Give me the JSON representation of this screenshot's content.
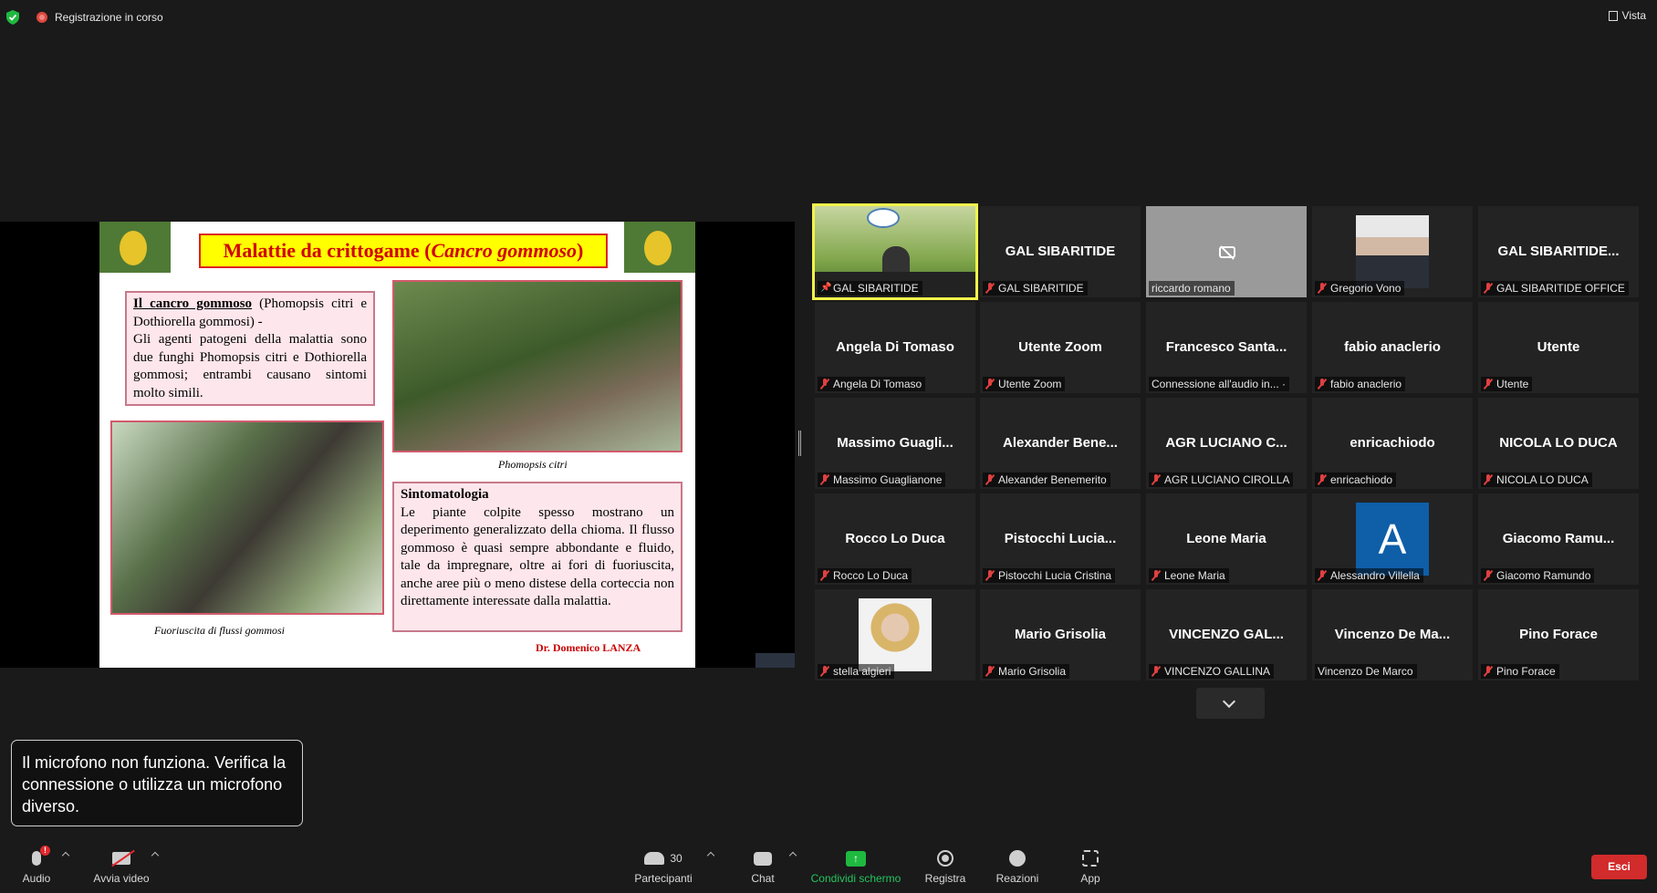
{
  "topbar": {
    "recording_label": "Registrazione in corso",
    "view_label": "Vista"
  },
  "slide": {
    "title_main": "Malattie da crittogame (",
    "title_italic": "Cancro gommoso",
    "title_end": ")",
    "box1_heading": "Il cancro gommoso",
    "box1_heading_rest": " (Phomopsis citri e Dothiorella gommosi) -",
    "box1_text": "Gli agenti patogeni della malattia sono due funghi Phomopsis citri e Dothiorella gommosi; entrambi causano sintomi molto simili.",
    "caption_top": "Phomopsis citri",
    "caption_bottom": "Fuoriuscita di flussi gommosi",
    "box2_heading": "Sintomatologia",
    "box2_text": "Le piante colpite spesso mostrano un deperimento generalizzato della chioma. Il flusso gommoso è quasi sempre abbondante e fluido, tale da impregnare, oltre ai fori di fuoriuscita, anche aree più o meno distese della corteccia non direttamente interessate dalla malattia.",
    "author": "Dr. Domenico LANZA"
  },
  "participants": [
    {
      "name": "",
      "label": "GAL SIBARITIDE",
      "type": "video",
      "muted": false,
      "pinned": true
    },
    {
      "name": "GAL SIBARITIDE",
      "label": "GAL SIBARITIDE",
      "type": "name",
      "muted": true
    },
    {
      "name": "",
      "label": "riccardo romano",
      "type": "camoff",
      "muted": false
    },
    {
      "name": "",
      "label": "Gregorio Vono",
      "type": "photo-man",
      "muted": true
    },
    {
      "name": "GAL SIBARITIDE...",
      "label": "GAL SIBARITIDE OFFICE",
      "type": "name",
      "muted": true
    },
    {
      "name": "Angela Di Tomaso",
      "label": "Angela Di Tomaso",
      "type": "name",
      "muted": true
    },
    {
      "name": "Utente Zoom",
      "label": "Utente Zoom",
      "type": "name",
      "muted": true
    },
    {
      "name": "Francesco  Santa...",
      "label": "Connessione all'audio in... ·",
      "type": "name",
      "muted": false
    },
    {
      "name": "fabio anaclerio",
      "label": "fabio anaclerio",
      "type": "name",
      "muted": true
    },
    {
      "name": "Utente",
      "label": "Utente",
      "type": "name",
      "muted": true
    },
    {
      "name": "Massimo  Guagli...",
      "label": "Massimo Guaglianone",
      "type": "name",
      "muted": true
    },
    {
      "name": "Alexander  Bene...",
      "label": "Alexander Benemerito",
      "type": "name",
      "muted": true
    },
    {
      "name": "AGR LUCIANO C...",
      "label": "AGR LUCIANO CIROLLA",
      "type": "name",
      "muted": true
    },
    {
      "name": "enricachiodo",
      "label": "enricachiodo",
      "type": "name",
      "muted": true
    },
    {
      "name": "NICOLA LO DUCA",
      "label": "NICOLA LO DUCA",
      "type": "name",
      "muted": true
    },
    {
      "name": "Rocco Lo Duca",
      "label": "Rocco Lo Duca",
      "type": "name",
      "muted": true
    },
    {
      "name": "Pistocchi  Lucia...",
      "label": "Pistocchi Lucia Cristina",
      "type": "name",
      "muted": true
    },
    {
      "name": "Leone Maria",
      "label": "Leone Maria",
      "type": "name",
      "muted": true
    },
    {
      "name": "A",
      "label": "Alessandro Villella",
      "type": "letter",
      "muted": true
    },
    {
      "name": "Giacomo  Ramu...",
      "label": "Giacomo Ramundo",
      "type": "name",
      "muted": true
    },
    {
      "name": "",
      "label": "stella algieri",
      "type": "photo-woman",
      "muted": true
    },
    {
      "name": "Mario Grisolia",
      "label": "Mario Grisolia",
      "type": "name",
      "muted": true
    },
    {
      "name": "VINCENZO GAL...",
      "label": "VINCENZO GALLINA",
      "type": "name",
      "muted": true
    },
    {
      "name": "Vincenzo  De  Ma...",
      "label": "Vincenzo De Marco",
      "type": "name",
      "muted": false
    },
    {
      "name": "Pino Forace",
      "label": "Pino Forace",
      "type": "name",
      "muted": true
    }
  ],
  "notice": {
    "text": "Il microfono non funziona. Verifica la connessione o utilizza un microfono diverso."
  },
  "toolbar": {
    "audio_label": "Audio",
    "audio_badge": "!",
    "video_label": "Avvia video",
    "participants_label": "Partecipanti",
    "participants_count": "30",
    "chat_label": "Chat",
    "share_label": "Condividi schermo",
    "record_label": "Registra",
    "reactions_label": "Reazioni",
    "apps_label": "App",
    "exit_label": "Esci"
  },
  "colors": {
    "active_speaker": "#f3f34a",
    "share_green": "#22c55e",
    "exit_red": "#d22b2b",
    "muted_red": "#e04040"
  },
  "icons": [
    "shield-icon",
    "recording-icon",
    "view-icon",
    "camera-off-icon",
    "mic-muted-icon",
    "pin-icon",
    "chevron-down-icon",
    "mic-icon",
    "video-off-icon",
    "participants-icon",
    "chat-icon",
    "share-screen-icon",
    "record-icon",
    "reactions-icon",
    "apps-icon"
  ]
}
